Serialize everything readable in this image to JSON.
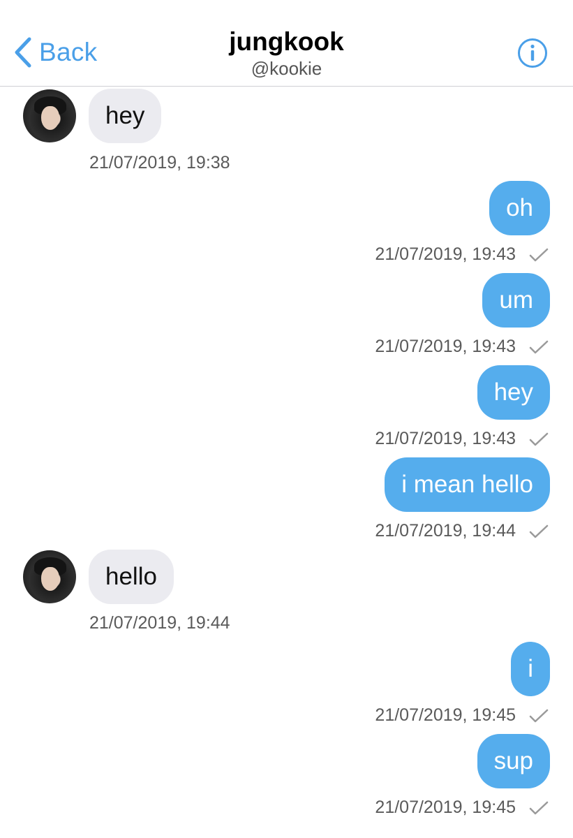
{
  "header": {
    "back_label": "Back",
    "title": "jungkook",
    "subtitle": "@kookie",
    "accent_color": "#4a9fe8",
    "back_icon": "chevron-left-icon",
    "info_icon": "info-circle-icon"
  },
  "messages": [
    {
      "direction": "incoming",
      "text": "hey",
      "timestamp": "21/07/2019, 19:38"
    },
    {
      "direction": "outgoing",
      "text": "oh",
      "timestamp": "21/07/2019, 19:43",
      "read": true
    },
    {
      "direction": "outgoing",
      "text": "um",
      "timestamp": "21/07/2019, 19:43",
      "read": true
    },
    {
      "direction": "outgoing",
      "text": "hey",
      "timestamp": "21/07/2019, 19:43",
      "read": true
    },
    {
      "direction": "outgoing",
      "text": "i mean hello",
      "timestamp": "21/07/2019, 19:44",
      "read": true
    },
    {
      "direction": "incoming",
      "text": "hello",
      "timestamp": "21/07/2019, 19:44"
    },
    {
      "direction": "outgoing",
      "text": "i",
      "timestamp": "21/07/2019, 19:45",
      "read": true
    },
    {
      "direction": "outgoing",
      "text": "sup",
      "timestamp": "21/07/2019, 19:45",
      "read": true
    }
  ],
  "colors": {
    "outgoing_bubble": "#55aded",
    "incoming_bubble": "#ebebf0",
    "timestamp": "#5a5a5a"
  }
}
